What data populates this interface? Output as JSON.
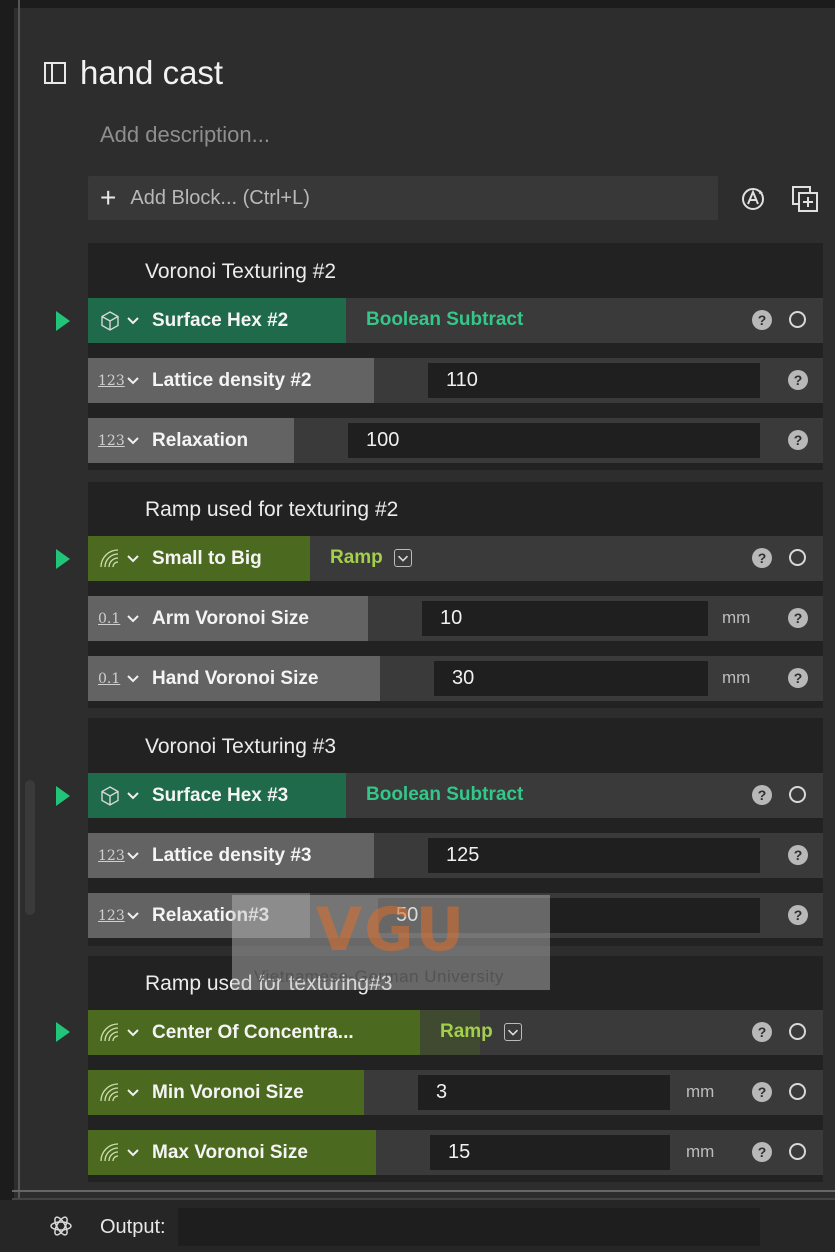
{
  "block": {
    "title": "hand cast",
    "description_placeholder": "Add description...",
    "add_block_label": "Add Block... (Ctrl+L)"
  },
  "groups": [
    {
      "title": "Voronoi Texturing #2",
      "header": {
        "name": "Surface Hex #2",
        "mode": "Boolean Subtract",
        "icon": "lattice-cube-icon"
      },
      "params": [
        {
          "glyph": "123",
          "name": "Lattice density #2",
          "value": "110",
          "unit": ""
        },
        {
          "glyph": "123",
          "name": "Relaxation",
          "value": "100",
          "unit": ""
        }
      ]
    },
    {
      "title": "Ramp used for texturing #2",
      "header": {
        "name": "Small to Big",
        "mode": "Ramp",
        "icon": "ramp-wave-icon"
      },
      "params": [
        {
          "glyph": "0.1",
          "name": "Arm Voronoi Size",
          "value": "10",
          "unit": "mm"
        },
        {
          "glyph": "0.1",
          "name": "Hand Voronoi Size",
          "value": "30",
          "unit": "mm"
        }
      ]
    },
    {
      "title": "Voronoi Texturing #3",
      "header": {
        "name": "Surface Hex #3",
        "mode": "Boolean Subtract",
        "icon": "lattice-cube-icon"
      },
      "params": [
        {
          "glyph": "123",
          "name": "Lattice density #3",
          "value": "125",
          "unit": ""
        },
        {
          "glyph": "123",
          "name": "Relaxation#3",
          "value": "50",
          "unit": ""
        }
      ]
    },
    {
      "title": "Ramp used for texturing#3",
      "header": {
        "name": "Center Of Concentra...",
        "mode": "Ramp",
        "icon": "ramp-wave-icon"
      },
      "params": [
        {
          "glyph": "",
          "name": "Min Voronoi Size",
          "value": "3",
          "unit": "mm"
        },
        {
          "glyph": "",
          "name": "Max Voronoi  Size",
          "value": "15",
          "unit": "mm"
        }
      ]
    }
  ],
  "output": {
    "label": "Output:",
    "value": ""
  },
  "watermark": {
    "logo": "VGU",
    "text": "Vietnamese-German University"
  },
  "colors": {
    "accent_teal": "#33c78a",
    "accent_olive": "#a3d04a",
    "play": "#22c47a"
  }
}
